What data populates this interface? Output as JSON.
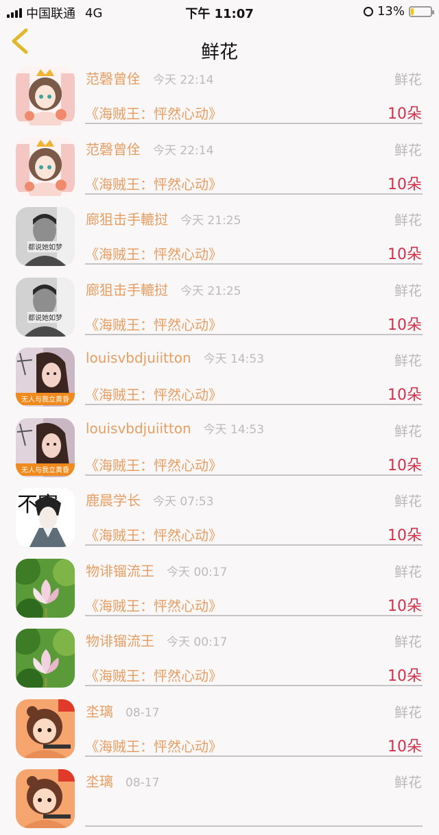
{
  "status_bar": {
    "carrier": "中国联通",
    "network": "4G",
    "time": "下午 11:07",
    "battery": "13%",
    "battery_level": 0.13,
    "battery_color": "#f3c400"
  },
  "nav": {
    "title": "鲜花",
    "back_icon": "chevron-left-icon",
    "back_color": "#e0b82e"
  },
  "rows": [
    {
      "name": "范磬曾佺",
      "time": "今天 22:14",
      "type": "鲜花",
      "book": "《海贼王：怦然心动》",
      "count": "10朵",
      "avatar": "anime-girl"
    },
    {
      "name": "范磬曾佺",
      "time": "今天 22:14",
      "type": "鲜花",
      "book": "《海贼王：怦然心动》",
      "count": "10朵",
      "avatar": "anime-girl"
    },
    {
      "name": "廊狙击手轆挝",
      "time": "今天 21:25",
      "type": "鲜花",
      "book": "《海贼王：怦然心动》",
      "count": "10朵",
      "avatar": "bw-photo",
      "avatar_caption": "都说她如梦"
    },
    {
      "name": "廊狙击手轆挝",
      "time": "今天 21:25",
      "type": "鲜花",
      "book": "《海贼王：怦然心动》",
      "count": "10朵",
      "avatar": "bw-photo",
      "avatar_caption": "都说她如梦"
    },
    {
      "name": "louisvbdjuiitton",
      "time": "今天 14:53",
      "type": "鲜花",
      "book": "《海贼王：怦然心动》",
      "count": "10朵",
      "avatar": "girl-photo",
      "avatar_caption": "无人与我立黄昏"
    },
    {
      "name": "louisvbdjuiitton",
      "time": "今天 14:53",
      "type": "鲜花",
      "book": "《海贼王：怦然心动》",
      "count": "10朵",
      "avatar": "girl-photo",
      "avatar_caption": "无人与我立黄昏"
    },
    {
      "name": "鹿晨学长",
      "time": "今天 07:53",
      "type": "鲜花",
      "book": "《海贼王：怦然心动》",
      "count": "10朵",
      "avatar": "manga-boy",
      "avatar_caption": "不寒"
    },
    {
      "name": "物诽镏流王",
      "time": "今天 00:17",
      "type": "鲜花",
      "book": "《海贼王：怦然心动》",
      "count": "10朵",
      "avatar": "lotus"
    },
    {
      "name": "物诽镏流王",
      "time": "今天 00:17",
      "type": "鲜花",
      "book": "《海贼王：怦然心动》",
      "count": "10朵",
      "avatar": "lotus"
    },
    {
      "name": "坔璃",
      "time": "08-17",
      "type": "鲜花",
      "book": "《海贼王：怦然心动》",
      "count": "10朵",
      "avatar": "cartoon-girl"
    },
    {
      "name": "坔璃",
      "time": "08-17",
      "type": "鲜花",
      "book": "",
      "count": "",
      "avatar": "cartoon-girl"
    }
  ],
  "colors": {
    "name": "#e79e62",
    "book": "#e79e62",
    "count": "#d3304a",
    "muted": "#b9b9b9",
    "background": "#f9f7f8"
  }
}
